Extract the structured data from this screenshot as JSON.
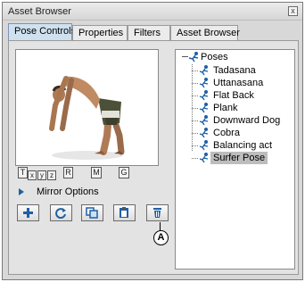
{
  "window": {
    "title": "Asset Browser",
    "close_label": "x"
  },
  "tabs": [
    {
      "label": "Pose Controls",
      "active": true
    },
    {
      "label": "Properties",
      "active": false
    },
    {
      "label": "Filters",
      "active": false
    },
    {
      "label": "Asset Browser",
      "active": false
    }
  ],
  "transform_buttons": {
    "t": "T",
    "x": "x",
    "y": "y",
    "z": "z",
    "r": "R",
    "m": "M",
    "g": "G"
  },
  "mirror_options": {
    "label": "Mirror Options"
  },
  "action_buttons": [
    {
      "name": "add",
      "icon": "plus-icon"
    },
    {
      "name": "refresh",
      "icon": "refresh-icon"
    },
    {
      "name": "copy",
      "icon": "copy-icon"
    },
    {
      "name": "paste",
      "icon": "paste-icon"
    },
    {
      "name": "delete",
      "icon": "trash-icon"
    }
  ],
  "callout": {
    "label": "A"
  },
  "tree": {
    "root_label": "Poses",
    "items": [
      "Tadasana",
      "Uttanasana",
      "Flat Back",
      "Plank",
      "Downward Dog",
      "Cobra",
      "Balancing act",
      "Surfer Pose"
    ],
    "selected": "Surfer Pose"
  },
  "colors": {
    "accent": "#1e5fa6",
    "active_tab": "#cfe0ef",
    "selection": "#bdbdbd"
  }
}
